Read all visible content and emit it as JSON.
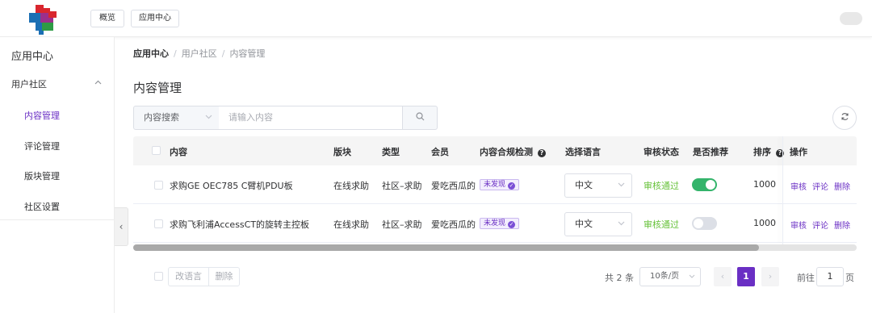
{
  "header": {
    "buttons": [
      "概览",
      "应用中心"
    ],
    "logo_colors": [
      "#d9262e",
      "#1b6fb4",
      "#2e9b45",
      "#9b2f8c"
    ]
  },
  "sidebar": {
    "title": "应用中心",
    "group": {
      "label": "用户社区",
      "icon": "chevron-up-icon"
    },
    "items": [
      {
        "label": "内容管理",
        "active": true
      },
      {
        "label": "评论管理",
        "active": false
      },
      {
        "label": "版块管理",
        "active": false
      },
      {
        "label": "社区设置",
        "active": false
      }
    ],
    "collapse_icon": "chevron-left-icon"
  },
  "breadcrumb": [
    "应用中心",
    "用户社区",
    "内容管理"
  ],
  "page_title": "内容管理",
  "search": {
    "type_value": "内容搜索",
    "placeholder": "请输入内容",
    "search_icon": "search-icon",
    "refresh_icon": "refresh-icon"
  },
  "table": {
    "columns": [
      "内容",
      "版块",
      "类型",
      "会员",
      "内容合规检测",
      "选择语言",
      "审核状态",
      "是否推荐",
      "排序",
      "操作"
    ],
    "rows": [
      {
        "content": "求购GE OEC785 C臂机PDU板",
        "section": "在线求助",
        "type": "社区–求助",
        "member": "爱吃西瓜的",
        "compliance": "未发现",
        "language": "中文",
        "status": "审核通过",
        "recommended": true,
        "sort": "1000",
        "actions": [
          "审核",
          "评论",
          "删除"
        ]
      },
      {
        "content": "求购飞利浦AccessCT的旋转主控板",
        "section": "在线求助",
        "type": "社区–求助",
        "member": "爱吃西瓜的",
        "compliance": "未发现",
        "language": "中文",
        "status": "审核通过",
        "recommended": false,
        "sort": "1000",
        "actions": [
          "审核",
          "评论",
          "删除"
        ]
      }
    ]
  },
  "footer": {
    "bulk_actions": [
      "改语言",
      "删除"
    ],
    "total": "共 2 条",
    "page_size": "10条/页",
    "current_page": "1",
    "goto_label": "前往",
    "goto_value": "1",
    "page_suffix": "页"
  },
  "colors": {
    "accent": "#6a2fc4",
    "success": "#67c23a",
    "switch_on": "#34b46b"
  }
}
